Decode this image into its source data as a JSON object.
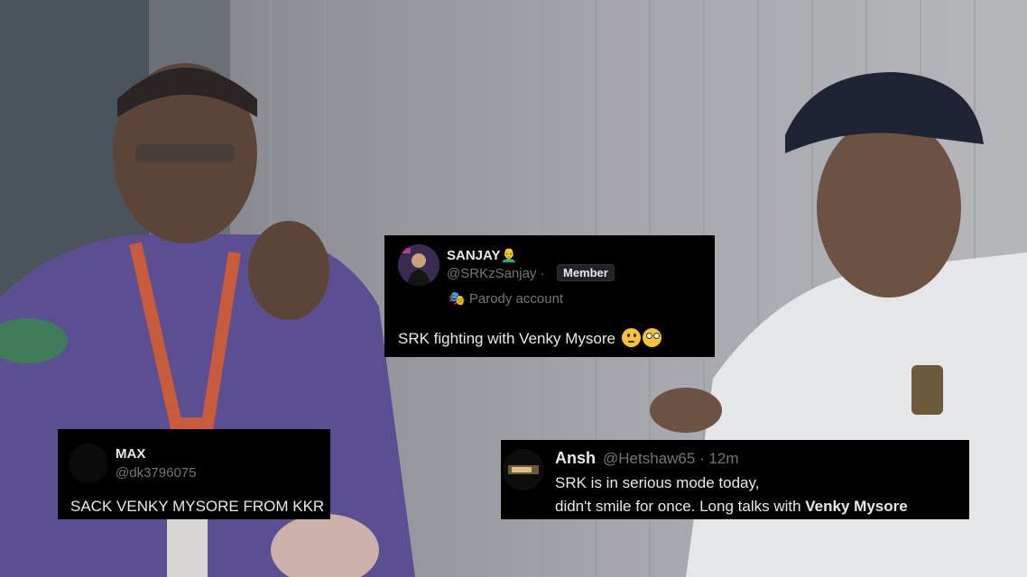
{
  "tweets": {
    "sanjay": {
      "display_name": "SANJAY",
      "name_emoji": "👨‍🦲",
      "handle": "@SRKzSanjay",
      "separator": "·",
      "badge": "Member",
      "parody_icon": "🎭",
      "parody_label": "Parody account",
      "text": "SRK fighting with Venky Mysore",
      "emojis": [
        "thinking-face-icon",
        "flushed-face-icon"
      ]
    },
    "max": {
      "display_name": "MAX",
      "handle": "@dk3796075",
      "text": "SACK VENKY MYSORE FROM KKR"
    },
    "ansh": {
      "display_name": "Ansh",
      "handle": "@Hetshaw65",
      "time": "· 12m",
      "line1": "SRK is in serious mode today,",
      "line2_prefix": "didn't smile for once. Long talks with ",
      "line2_bold": "Venky Mysore"
    }
  },
  "colors": {
    "card_bg": "#000000",
    "text_primary": "#e7e9ea",
    "text_secondary": "#71767b"
  }
}
